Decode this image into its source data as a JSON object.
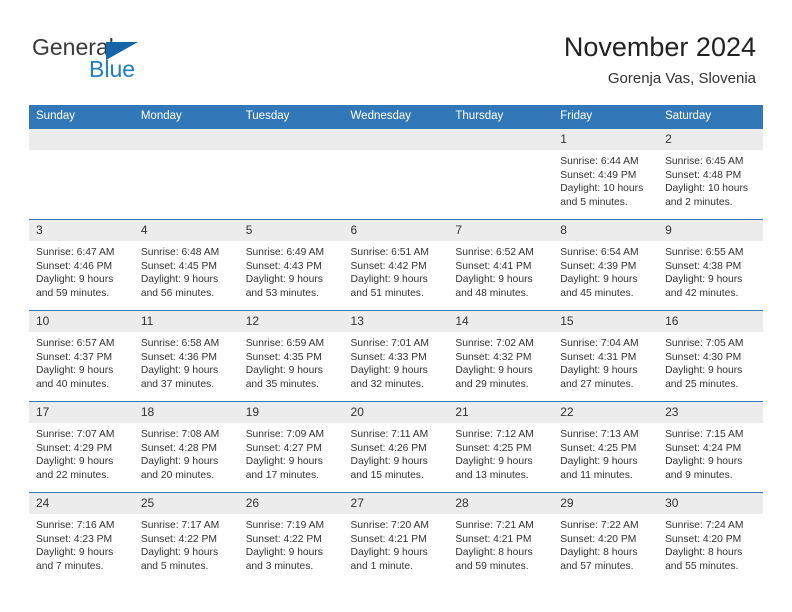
{
  "brand": {
    "name_part1": "General",
    "name_part2": "Blue"
  },
  "header": {
    "title": "November 2024",
    "subtitle": "Gorenja Vas, Slovenia"
  },
  "weekday_headers": [
    "Sunday",
    "Monday",
    "Tuesday",
    "Wednesday",
    "Thursday",
    "Friday",
    "Saturday"
  ],
  "colors": {
    "header_blue": "#3278b8",
    "logo_blue": "#1f7ec4",
    "daynum_band": "#ececec",
    "text": "#333333"
  },
  "weeks": [
    [
      {
        "day": "",
        "sunrise": "",
        "sunset": "",
        "daylight": "",
        "empty": true
      },
      {
        "day": "",
        "sunrise": "",
        "sunset": "",
        "daylight": "",
        "empty": true
      },
      {
        "day": "",
        "sunrise": "",
        "sunset": "",
        "daylight": "",
        "empty": true
      },
      {
        "day": "",
        "sunrise": "",
        "sunset": "",
        "daylight": "",
        "empty": true
      },
      {
        "day": "",
        "sunrise": "",
        "sunset": "",
        "daylight": "",
        "empty": true
      },
      {
        "day": "1",
        "sunrise": "Sunrise: 6:44 AM",
        "sunset": "Sunset: 4:49 PM",
        "daylight": "Daylight: 10 hours and 5 minutes."
      },
      {
        "day": "2",
        "sunrise": "Sunrise: 6:45 AM",
        "sunset": "Sunset: 4:48 PM",
        "daylight": "Daylight: 10 hours and 2 minutes."
      }
    ],
    [
      {
        "day": "3",
        "sunrise": "Sunrise: 6:47 AM",
        "sunset": "Sunset: 4:46 PM",
        "daylight": "Daylight: 9 hours and 59 minutes."
      },
      {
        "day": "4",
        "sunrise": "Sunrise: 6:48 AM",
        "sunset": "Sunset: 4:45 PM",
        "daylight": "Daylight: 9 hours and 56 minutes."
      },
      {
        "day": "5",
        "sunrise": "Sunrise: 6:49 AM",
        "sunset": "Sunset: 4:43 PM",
        "daylight": "Daylight: 9 hours and 53 minutes."
      },
      {
        "day": "6",
        "sunrise": "Sunrise: 6:51 AM",
        "sunset": "Sunset: 4:42 PM",
        "daylight": "Daylight: 9 hours and 51 minutes."
      },
      {
        "day": "7",
        "sunrise": "Sunrise: 6:52 AM",
        "sunset": "Sunset: 4:41 PM",
        "daylight": "Daylight: 9 hours and 48 minutes."
      },
      {
        "day": "8",
        "sunrise": "Sunrise: 6:54 AM",
        "sunset": "Sunset: 4:39 PM",
        "daylight": "Daylight: 9 hours and 45 minutes."
      },
      {
        "day": "9",
        "sunrise": "Sunrise: 6:55 AM",
        "sunset": "Sunset: 4:38 PM",
        "daylight": "Daylight: 9 hours and 42 minutes."
      }
    ],
    [
      {
        "day": "10",
        "sunrise": "Sunrise: 6:57 AM",
        "sunset": "Sunset: 4:37 PM",
        "daylight": "Daylight: 9 hours and 40 minutes."
      },
      {
        "day": "11",
        "sunrise": "Sunrise: 6:58 AM",
        "sunset": "Sunset: 4:36 PM",
        "daylight": "Daylight: 9 hours and 37 minutes."
      },
      {
        "day": "12",
        "sunrise": "Sunrise: 6:59 AM",
        "sunset": "Sunset: 4:35 PM",
        "daylight": "Daylight: 9 hours and 35 minutes."
      },
      {
        "day": "13",
        "sunrise": "Sunrise: 7:01 AM",
        "sunset": "Sunset: 4:33 PM",
        "daylight": "Daylight: 9 hours and 32 minutes."
      },
      {
        "day": "14",
        "sunrise": "Sunrise: 7:02 AM",
        "sunset": "Sunset: 4:32 PM",
        "daylight": "Daylight: 9 hours and 29 minutes."
      },
      {
        "day": "15",
        "sunrise": "Sunrise: 7:04 AM",
        "sunset": "Sunset: 4:31 PM",
        "daylight": "Daylight: 9 hours and 27 minutes."
      },
      {
        "day": "16",
        "sunrise": "Sunrise: 7:05 AM",
        "sunset": "Sunset: 4:30 PM",
        "daylight": "Daylight: 9 hours and 25 minutes."
      }
    ],
    [
      {
        "day": "17",
        "sunrise": "Sunrise: 7:07 AM",
        "sunset": "Sunset: 4:29 PM",
        "daylight": "Daylight: 9 hours and 22 minutes."
      },
      {
        "day": "18",
        "sunrise": "Sunrise: 7:08 AM",
        "sunset": "Sunset: 4:28 PM",
        "daylight": "Daylight: 9 hours and 20 minutes."
      },
      {
        "day": "19",
        "sunrise": "Sunrise: 7:09 AM",
        "sunset": "Sunset: 4:27 PM",
        "daylight": "Daylight: 9 hours and 17 minutes."
      },
      {
        "day": "20",
        "sunrise": "Sunrise: 7:11 AM",
        "sunset": "Sunset: 4:26 PM",
        "daylight": "Daylight: 9 hours and 15 minutes."
      },
      {
        "day": "21",
        "sunrise": "Sunrise: 7:12 AM",
        "sunset": "Sunset: 4:25 PM",
        "daylight": "Daylight: 9 hours and 13 minutes."
      },
      {
        "day": "22",
        "sunrise": "Sunrise: 7:13 AM",
        "sunset": "Sunset: 4:25 PM",
        "daylight": "Daylight: 9 hours and 11 minutes."
      },
      {
        "day": "23",
        "sunrise": "Sunrise: 7:15 AM",
        "sunset": "Sunset: 4:24 PM",
        "daylight": "Daylight: 9 hours and 9 minutes."
      }
    ],
    [
      {
        "day": "24",
        "sunrise": "Sunrise: 7:16 AM",
        "sunset": "Sunset: 4:23 PM",
        "daylight": "Daylight: 9 hours and 7 minutes."
      },
      {
        "day": "25",
        "sunrise": "Sunrise: 7:17 AM",
        "sunset": "Sunset: 4:22 PM",
        "daylight": "Daylight: 9 hours and 5 minutes."
      },
      {
        "day": "26",
        "sunrise": "Sunrise: 7:19 AM",
        "sunset": "Sunset: 4:22 PM",
        "daylight": "Daylight: 9 hours and 3 minutes."
      },
      {
        "day": "27",
        "sunrise": "Sunrise: 7:20 AM",
        "sunset": "Sunset: 4:21 PM",
        "daylight": "Daylight: 9 hours and 1 minute."
      },
      {
        "day": "28",
        "sunrise": "Sunrise: 7:21 AM",
        "sunset": "Sunset: 4:21 PM",
        "daylight": "Daylight: 8 hours and 59 minutes."
      },
      {
        "day": "29",
        "sunrise": "Sunrise: 7:22 AM",
        "sunset": "Sunset: 4:20 PM",
        "daylight": "Daylight: 8 hours and 57 minutes."
      },
      {
        "day": "30",
        "sunrise": "Sunrise: 7:24 AM",
        "sunset": "Sunset: 4:20 PM",
        "daylight": "Daylight: 8 hours and 55 minutes."
      }
    ]
  ]
}
